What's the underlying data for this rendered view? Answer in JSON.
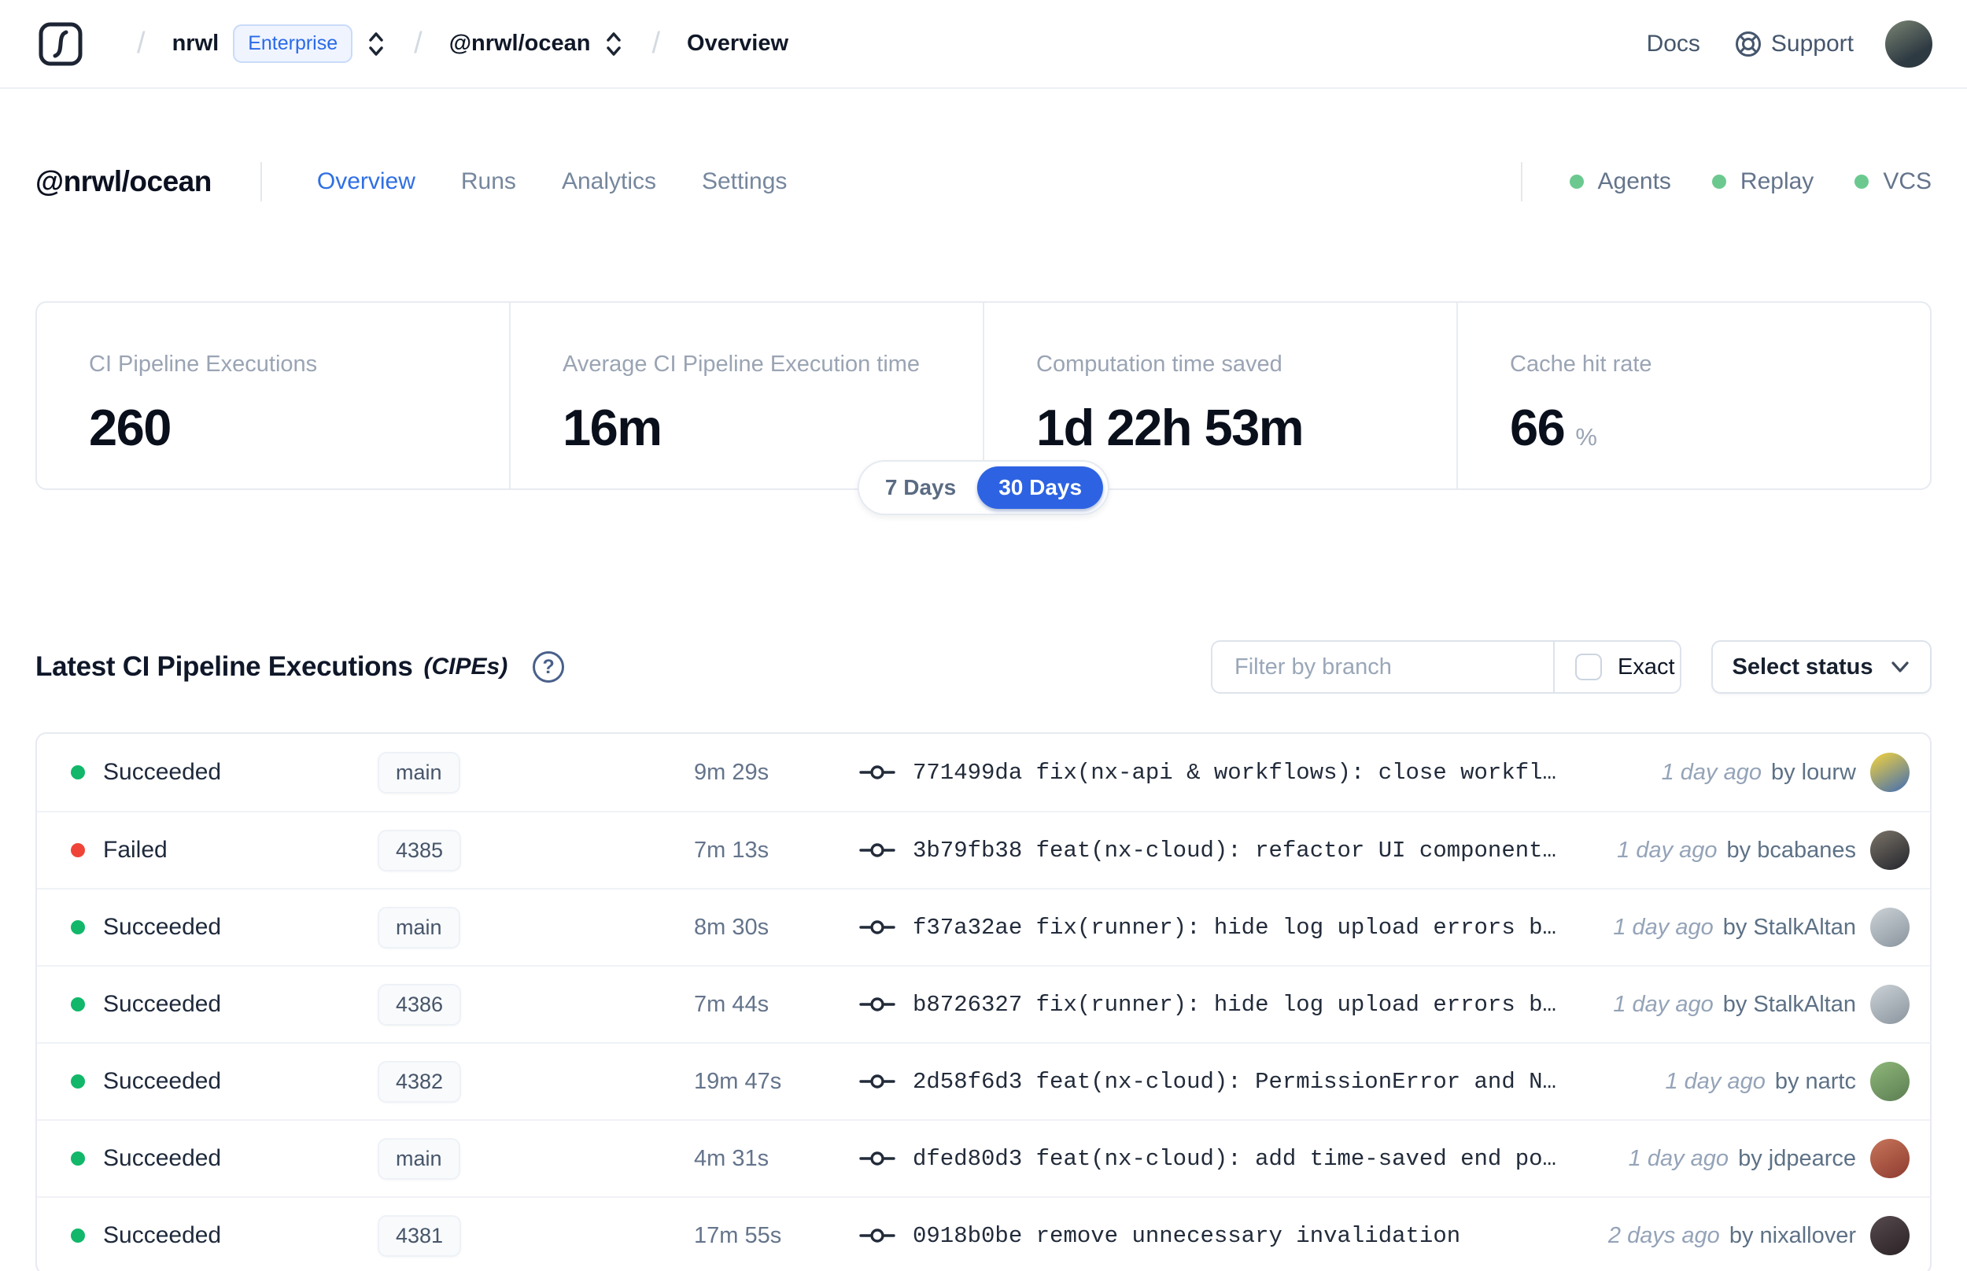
{
  "colors": {
    "accent_blue": "#2d63e2",
    "active_tab_blue": "#2f6fe4",
    "success_green": "#12b76a",
    "failed_red": "#f04438",
    "feature_status_green": "#6bc98f"
  },
  "header": {
    "separator": "/",
    "breadcrumb": {
      "org": "nrwl",
      "org_badge": "Enterprise",
      "workspace": "@nrwl/ocean",
      "page": "Overview"
    },
    "docs_label": "Docs",
    "support_label": "Support"
  },
  "workspace": {
    "title": "@nrwl/ocean",
    "tabs": [
      {
        "label": "Overview",
        "active": true
      },
      {
        "label": "Runs",
        "active": false
      },
      {
        "label": "Analytics",
        "active": false
      },
      {
        "label": "Settings",
        "active": false
      }
    ],
    "feature_statuses": [
      {
        "label": "Agents",
        "color": "#6bc98f"
      },
      {
        "label": "Replay",
        "color": "#6bc98f"
      },
      {
        "label": "VCS",
        "color": "#6bc98f"
      }
    ]
  },
  "stats": {
    "cards": [
      {
        "label": "CI Pipeline Executions",
        "value": "260",
        "suffix": ""
      },
      {
        "label": "Average CI Pipeline Execution time",
        "value": "16m",
        "suffix": ""
      },
      {
        "label": "Computation time saved",
        "value": "1d 22h 53m",
        "suffix": ""
      },
      {
        "label": "Cache hit rate",
        "value": "66",
        "suffix": "%"
      }
    ],
    "range_toggle": {
      "options": [
        "7 Days",
        "30 Days"
      ],
      "selected": "30 Days"
    }
  },
  "cipe_section": {
    "title": "Latest CI Pipeline Executions",
    "title_suffix": "(CIPEs)",
    "help_glyph": "?",
    "filter_placeholder": "Filter by branch",
    "exact_label": "Exact",
    "status_dropdown_label": "Select status"
  },
  "table": {
    "rows": [
      {
        "status": "Succeeded",
        "status_color": "#12b76a",
        "branch": "main",
        "duration": "9m 29s",
        "hash": "771499da",
        "message": "fix(nx-api & workflows): close workfl…",
        "time_ago": "1 day ago",
        "author": "by lourw",
        "avatar": [
          "#f6d43c",
          "#3f6cb4"
        ]
      },
      {
        "status": "Failed",
        "status_color": "#f04438",
        "branch": "4385",
        "duration": "7m 13s",
        "hash": "3b79fb38",
        "message": "feat(nx-cloud): refactor UI component…",
        "time_ago": "1 day ago",
        "author": "by bcabanes",
        "avatar": [
          "#7b7468",
          "#23242c"
        ]
      },
      {
        "status": "Succeeded",
        "status_color": "#12b76a",
        "branch": "main",
        "duration": "8m 30s",
        "hash": "f37a32ae",
        "message": "fix(runner): hide log upload errors b…",
        "time_ago": "1 day ago",
        "author": "by StalkAltan",
        "avatar": [
          "#ccd3d8",
          "#8a949d"
        ]
      },
      {
        "status": "Succeeded",
        "status_color": "#12b76a",
        "branch": "4386",
        "duration": "7m 44s",
        "hash": "b8726327",
        "message": "fix(runner): hide log upload errors b…",
        "time_ago": "1 day ago",
        "author": "by StalkAltan",
        "avatar": [
          "#ccd3d8",
          "#8a949d"
        ]
      },
      {
        "status": "Succeeded",
        "status_color": "#12b76a",
        "branch": "4382",
        "duration": "19m 47s",
        "hash": "2d58f6d3",
        "message": "feat(nx-cloud): PermissionError and N…",
        "time_ago": "1 day ago",
        "author": "by nartc",
        "avatar": [
          "#8fb87a",
          "#5c7d52"
        ]
      },
      {
        "status": "Succeeded",
        "status_color": "#12b76a",
        "branch": "main",
        "duration": "4m 31s",
        "hash": "dfed80d3",
        "message": "feat(nx-cloud): add time-saved end po…",
        "time_ago": "1 day ago",
        "author": "by jdpearce",
        "avatar": [
          "#c7755a",
          "#8e3b30"
        ]
      },
      {
        "status": "Succeeded",
        "status_color": "#12b76a",
        "branch": "4381",
        "duration": "17m 55s",
        "hash": "0918b0be",
        "message": "remove unnecessary invalidation",
        "time_ago": "2 days ago",
        "author": "by nixallover",
        "avatar": [
          "#564a4e",
          "#2b2326"
        ]
      }
    ]
  }
}
